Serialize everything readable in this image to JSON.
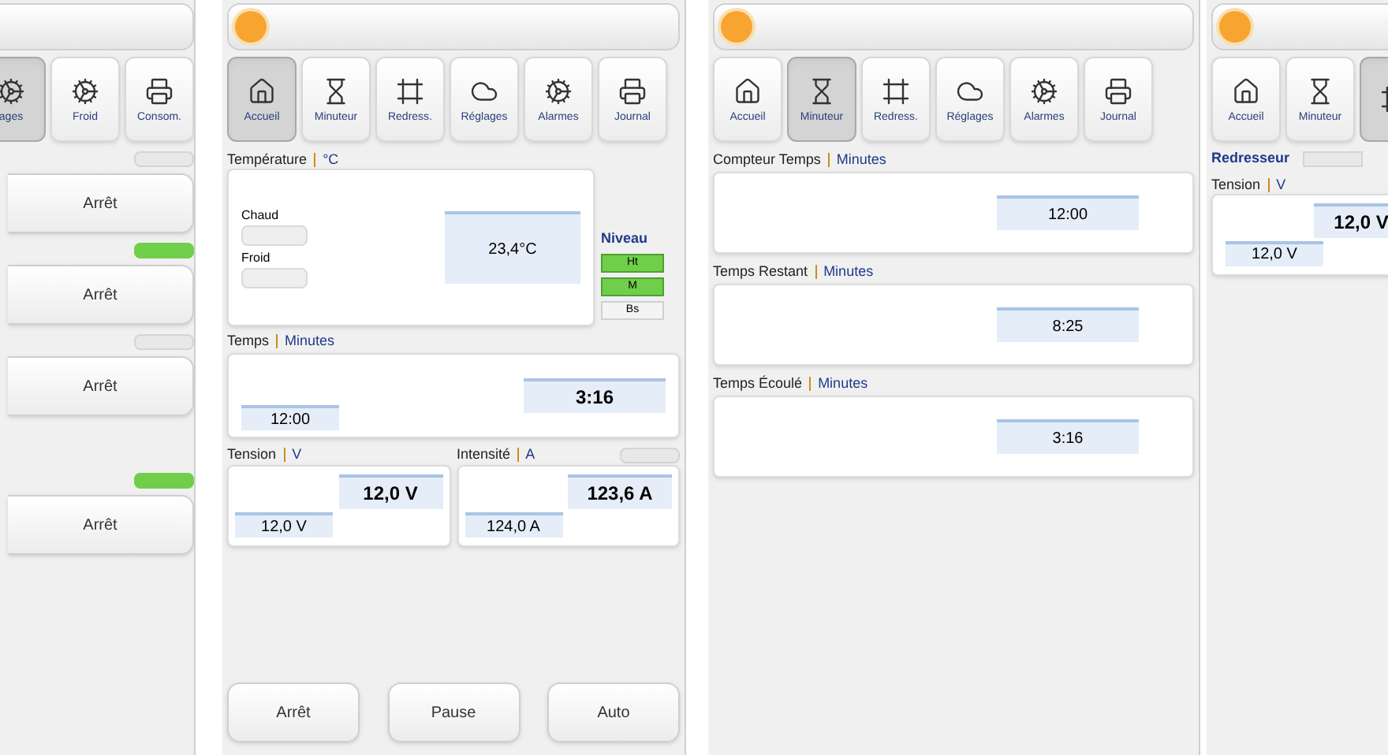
{
  "panels": [
    {
      "kind": "controls",
      "tabs": [
        {
          "label": "ages",
          "selected": true
        },
        {
          "label": "Froid",
          "selected": false
        },
        {
          "label": "Consom.",
          "selected": false
        }
      ],
      "rows": [
        {
          "on": false,
          "button": "Arrêt"
        },
        {
          "on": true,
          "button": "Arrêt"
        },
        {
          "on": false,
          "button": "Arrêt"
        },
        {
          "on": true,
          "button": "Arrêt"
        }
      ]
    },
    {
      "kind": "home",
      "tabs": [
        {
          "label": "Accueil",
          "selected": true
        },
        {
          "label": "Minuteur",
          "selected": false
        },
        {
          "label": "Redress.",
          "selected": false
        },
        {
          "label": "Réglages",
          "selected": false
        },
        {
          "label": "Alarmes",
          "selected": false
        },
        {
          "label": "Journal",
          "selected": false
        }
      ],
      "temperature": {
        "title": "Température",
        "unit": "°C",
        "modes": [
          "Chaud",
          "Froid"
        ],
        "value": "23,4°C",
        "level_title": "Niveau",
        "levels": [
          {
            "label": "Ht",
            "on": true
          },
          {
            "label": "M",
            "on": true
          },
          {
            "label": "Bs",
            "on": false
          }
        ]
      },
      "time": {
        "title": "Temps",
        "unit": "Minutes",
        "setpoint": "12:00",
        "value": "3:16"
      },
      "voltage": {
        "title": "Tension",
        "unit": "V",
        "value": "12,0 V",
        "setpoint": "12,0 V"
      },
      "current": {
        "title": "Intensité",
        "unit": "A",
        "value": "123,6 A",
        "setpoint": "124,0 A",
        "indicator_on": false
      },
      "buttons": [
        "Arrêt",
        "Pause",
        "Auto"
      ]
    },
    {
      "kind": "timer",
      "tabs": [
        {
          "label": "Accueil",
          "selected": false
        },
        {
          "label": "Minuteur",
          "selected": true
        },
        {
          "label": "Redress.",
          "selected": false
        },
        {
          "label": "Réglages",
          "selected": false
        },
        {
          "label": "Alarmes",
          "selected": false
        },
        {
          "label": "Journal",
          "selected": false
        }
      ],
      "sections": [
        {
          "title": "Compteur Temps",
          "unit": "Minutes",
          "value": "12:00"
        },
        {
          "title": "Temps Restant",
          "unit": "Minutes",
          "value": "8:25"
        },
        {
          "title": "Temps Écoulé",
          "unit": "Minutes",
          "value": "3:16"
        }
      ]
    },
    {
      "kind": "rectifier",
      "tabs": [
        {
          "label": "Accueil",
          "selected": false
        },
        {
          "label": "Minuteur",
          "selected": false
        },
        {
          "selected": true
        }
      ],
      "label": "Redresseur",
      "voltage": {
        "title": "Tension",
        "unit": "V",
        "value": "12,0 V",
        "setpoint": "12,0 V"
      }
    }
  ]
}
